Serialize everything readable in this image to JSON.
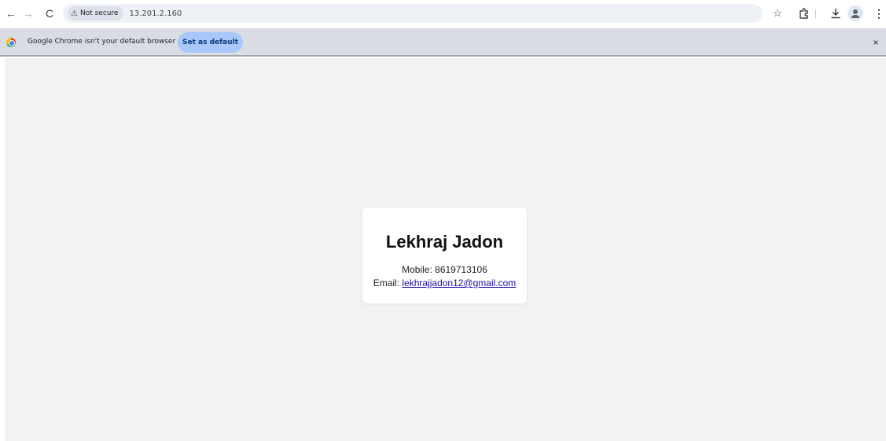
{
  "toolbar": {
    "back_glyph": "←",
    "forward_glyph": "→",
    "reload_glyph": "C",
    "security_label": "Not secure",
    "url": "13.201.2.160",
    "star_glyph": "☆",
    "download_glyph": "⤓",
    "menu_glyph": "⋮"
  },
  "infobar": {
    "message": "Google Chrome isn't your default browser",
    "button_label": "Set as default",
    "close_glyph": "×"
  },
  "page": {
    "name": "Lekhraj Jadon",
    "mobile_label": "Mobile:",
    "mobile": "8619713106",
    "email_label": "Email:",
    "email": "lekhrajjadon12@gmail.com"
  },
  "colors": {
    "page_background": "#f2f2f2",
    "infobar_background": "#d9dce3",
    "button_background": "#a8c7fa",
    "link_color": "#1a0dab"
  },
  "icons": [
    "back-icon",
    "forward-icon",
    "reload-icon",
    "warning-icon",
    "star-icon",
    "extensions-icon",
    "download-icon",
    "profile-icon",
    "menu-icon",
    "chrome-logo-icon",
    "close-icon"
  ]
}
